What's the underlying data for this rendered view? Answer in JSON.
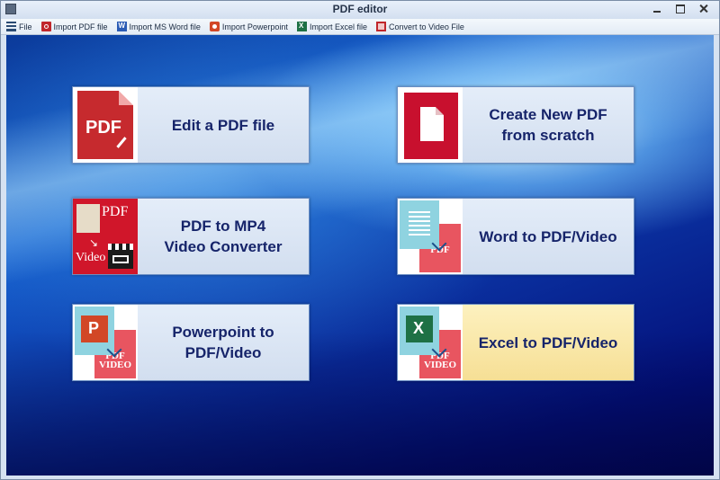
{
  "window": {
    "title": "PDF editor"
  },
  "menu": [
    {
      "label": "File",
      "icon": "menu-list-icon"
    },
    {
      "label": "Import PDF file",
      "icon": "pdf-icon"
    },
    {
      "label": "Import MS Word file",
      "icon": "word-icon"
    },
    {
      "label": "Import Powerpoint",
      "icon": "powerpoint-icon"
    },
    {
      "label": "Import Excel file",
      "icon": "excel-icon"
    },
    {
      "label": "Convert to Video File",
      "icon": "video-icon"
    }
  ],
  "tiles": [
    {
      "label": "Edit a PDF file",
      "icon": "pdf-edit-icon",
      "thumb_text": "PDF"
    },
    {
      "label": "Create New PDF\nfrom scratch",
      "icon": "new-document-icon"
    },
    {
      "label": "PDF to MP4\nVideo Converter",
      "icon": "pdf-to-video-icon",
      "thumb_text": "PDF",
      "thumb_subtext": "Video"
    },
    {
      "label": "Word to PDF/Video",
      "icon": "word-to-pdf-icon",
      "thumb_text": "PDF"
    },
    {
      "label": "Powerpoint to\nPDF/Video",
      "icon": "powerpoint-to-pdf-icon",
      "thumb_text": "PDF VIDEO"
    },
    {
      "label": "Excel to PDF/Video",
      "icon": "excel-to-pdf-icon",
      "thumb_text": "PDF VIDEO",
      "highlighted": true
    }
  ],
  "colors": {
    "tile_text": "#16246a",
    "highlight": "#f6df95",
    "pdf_red": "#c62a2e"
  }
}
